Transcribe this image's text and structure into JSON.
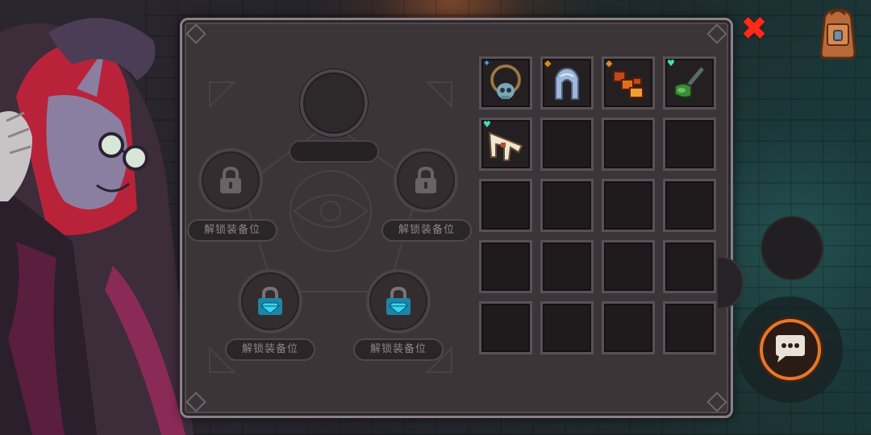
{
  "close_button": {
    "glyph": "✖",
    "color": "#ff2a1a",
    "icon": "close-x-icon"
  },
  "backpack_button": {
    "icon": "backpack-icon"
  },
  "equipment": {
    "main_slot": {
      "icon": "empty-equipment-slot",
      "label": ""
    },
    "locked_slots": [
      {
        "label": "解锁装备位",
        "icon": "padlock-icon",
        "gem": false
      },
      {
        "label": "解锁装备位",
        "icon": "padlock-icon",
        "gem": false
      },
      {
        "label": "解锁装备位",
        "icon": "gem-padlock-icon",
        "gem": true
      },
      {
        "label": "解锁装备位",
        "icon": "gem-padlock-icon",
        "gem": true
      }
    ]
  },
  "inventory": {
    "items": [
      {
        "name": "skull-amulet-icon",
        "badge": "✦",
        "badge_color": "#4aa8ff"
      },
      {
        "name": "steel-armor-icon",
        "badge": "◆",
        "badge_color": "#e08a1a"
      },
      {
        "name": "flame-gauntlet-icon",
        "badge": "◆",
        "badge_color": "#e08a1a"
      },
      {
        "name": "green-axe-icon",
        "badge": "♥",
        "badge_color": "#40e0b0"
      },
      {
        "name": "bone-claw-icon",
        "badge": "♥",
        "badge_color": "#40e0b0"
      }
    ],
    "empty_cells": 15
  },
  "controls": {
    "chat_button": {
      "icon": "chat-bubble-icon"
    }
  }
}
